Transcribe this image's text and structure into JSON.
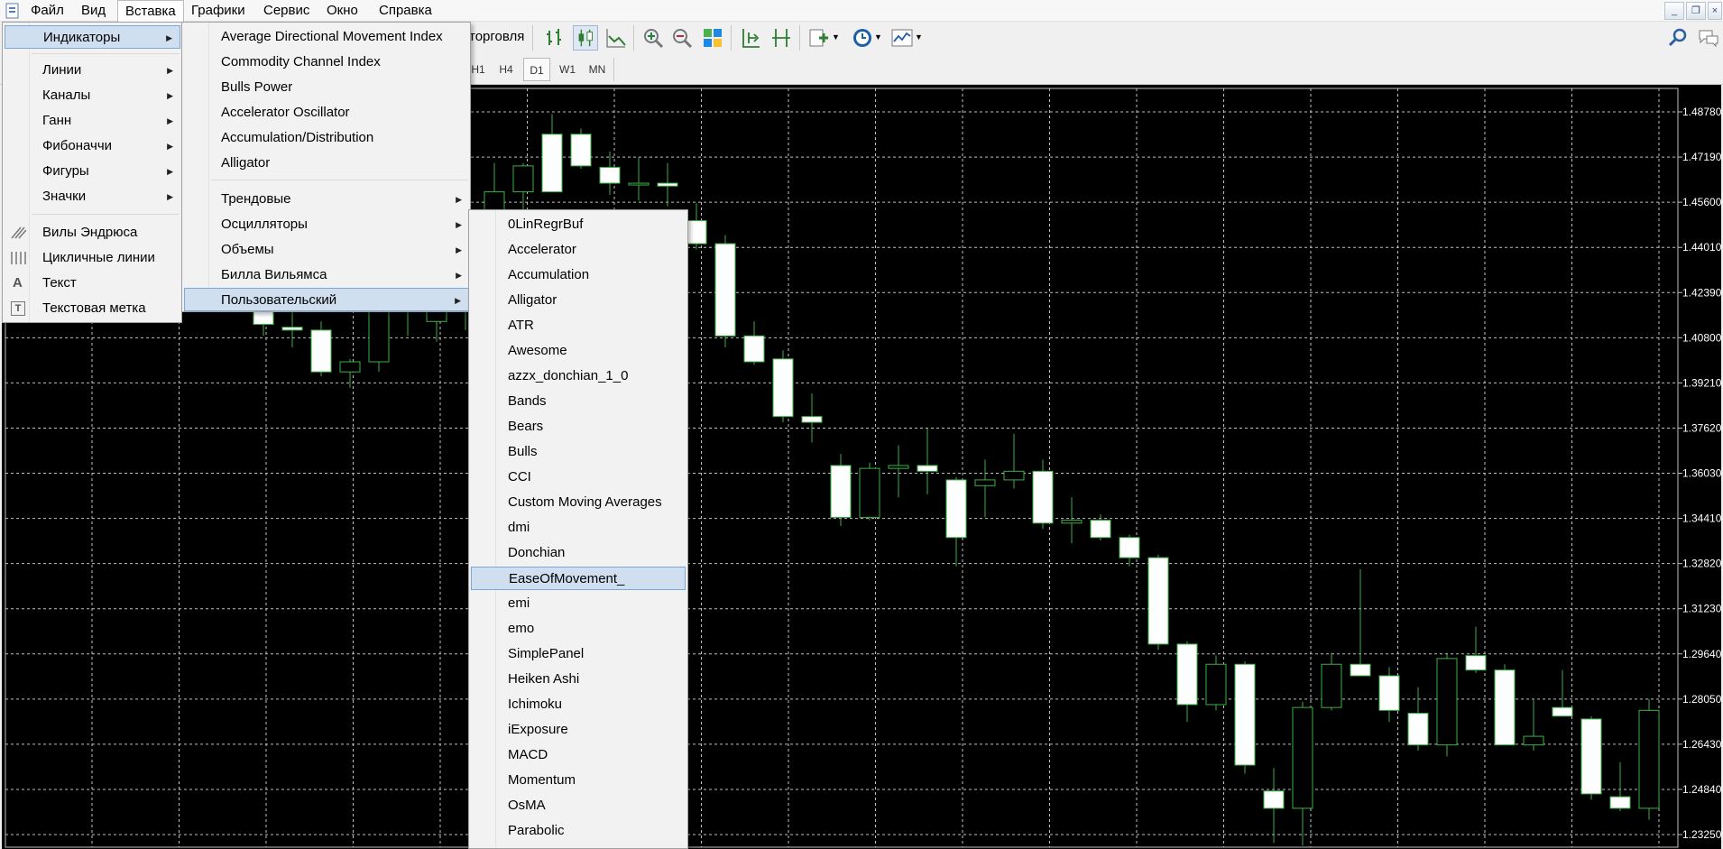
{
  "menubar": {
    "items": [
      "Файл",
      "Вид",
      "Вставка",
      "Графики",
      "Сервис",
      "Окно",
      "Справка"
    ],
    "active": "Вставка"
  },
  "toolbar": {
    "partial_label": "торговля",
    "timeframes": [
      "H1",
      "H4",
      "D1",
      "W1",
      "MN"
    ],
    "selected_timeframe": "D1"
  },
  "insert_menu": {
    "items": [
      {
        "label": "Индикаторы",
        "submenu": true,
        "highlighted": true
      },
      {
        "label": "Линии",
        "submenu": true
      },
      {
        "label": "Каналы",
        "submenu": true
      },
      {
        "label": "Ганн",
        "submenu": true
      },
      {
        "label": "Фибоначчи",
        "submenu": true
      },
      {
        "label": "Фигуры",
        "submenu": true
      },
      {
        "label": "Значки",
        "submenu": true
      },
      {
        "label": "Вилы Эндрюса",
        "icon": "pitchfork-icon"
      },
      {
        "label": "Цикличные линии",
        "icon": "cycle-lines-icon"
      },
      {
        "label": "Текст",
        "icon": "text-icon"
      },
      {
        "label": "Текстовая метка",
        "icon": "text-label-icon"
      }
    ]
  },
  "indicators_menu": {
    "items": [
      {
        "label": "Average Directional Movement Index"
      },
      {
        "label": "Commodity Channel Index"
      },
      {
        "label": "Bulls Power"
      },
      {
        "label": "Accelerator Oscillator"
      },
      {
        "label": "Accumulation/Distribution"
      },
      {
        "label": "Alligator"
      },
      {
        "label": "Трендовые",
        "submenu": true
      },
      {
        "label": "Осцилляторы",
        "submenu": true
      },
      {
        "label": "Объемы",
        "submenu": true
      },
      {
        "label": "Билла Вильямса",
        "submenu": true
      },
      {
        "label": "Пользовательский",
        "submenu": true,
        "highlighted": true
      }
    ]
  },
  "custom_menu": {
    "items": [
      "0LinRegrBuf",
      "Accelerator",
      "Accumulation",
      "Alligator",
      "ATR",
      "Awesome",
      "azzx_donchian_1_0",
      "Bands",
      "Bears",
      "Bulls",
      "CCI",
      "Custom Moving Averages",
      "dmi",
      "Donchian",
      "EaseOfMovement_",
      "emi",
      "emo",
      "SimplePanel",
      "Heiken Ashi",
      "Ichimoku",
      "iExposure",
      "MACD",
      "Momentum",
      "OsMA",
      "Parabolic"
    ],
    "highlighted": "EaseOfMovement_"
  },
  "chart": {
    "background": "#000000",
    "grid_color": "#c0c0c0",
    "candle_up_fill": "#000000",
    "candle_down_fill": "#ffffff",
    "candle_outline": "#3cb043",
    "price_labels": [
      "1.48780",
      "1.47190",
      "1.45600",
      "1.44010",
      "1.42390",
      "1.40800",
      "1.39210",
      "1.37620",
      "1.36030",
      "1.34410",
      "1.32820",
      "1.31230",
      "1.29640",
      "1.28050",
      "1.26430",
      "1.24840",
      "1.23250"
    ]
  },
  "chart_data": {
    "type": "candlestick",
    "ylim": [
      1.2325,
      1.4959
    ],
    "candles": [
      {
        "o": 1.425,
        "h": 1.43,
        "l": 1.41,
        "c": 1.414
      },
      {
        "o": 1.413,
        "h": 1.419,
        "l": 1.406,
        "c": 1.412
      },
      {
        "o": 1.412,
        "h": 1.415,
        "l": 1.396,
        "c": 1.3975
      },
      {
        "o": 1.3975,
        "h": 1.402,
        "l": 1.392,
        "c": 1.401
      },
      {
        "o": 1.401,
        "h": 1.426,
        "l": 1.3975,
        "c": 1.419
      },
      {
        "o": 1.421,
        "h": 1.428,
        "l": 1.41,
        "c": 1.42
      },
      {
        "o": 1.415,
        "h": 1.426,
        "l": 1.408,
        "c": 1.423
      },
      {
        "o": 1.419,
        "h": 1.45,
        "l": 1.412,
        "c": 1.44
      },
      {
        "o": 1.44,
        "h": 1.47,
        "l": 1.43,
        "c": 1.46
      },
      {
        "o": 1.46,
        "h": 1.47,
        "l": 1.445,
        "c": 1.469
      },
      {
        "o": 1.48,
        "h": 1.487,
        "l": 1.46,
        "c": 1.46
      },
      {
        "o": 1.48,
        "h": 1.482,
        "l": 1.468,
        "c": 1.469
      },
      {
        "o": 1.4685,
        "h": 1.474,
        "l": 1.459,
        "c": 1.463
      },
      {
        "o": 1.463,
        "h": 1.472,
        "l": 1.457,
        "c": 1.463
      },
      {
        "o": 1.463,
        "h": 1.47,
        "l": 1.455,
        "c": 1.462
      },
      {
        "o": 1.45,
        "h": 1.456,
        "l": 1.44,
        "c": 1.442
      },
      {
        "o": 1.442,
        "h": 1.445,
        "l": 1.406,
        "c": 1.41
      },
      {
        "o": 1.41,
        "h": 1.415,
        "l": 1.4,
        "c": 1.401
      },
      {
        "o": 1.402,
        "h": 1.405,
        "l": 1.38,
        "c": 1.382
      },
      {
        "o": 1.382,
        "h": 1.39,
        "l": 1.373,
        "c": 1.38
      },
      {
        "o": 1.365,
        "h": 1.369,
        "l": 1.344,
        "c": 1.347
      },
      {
        "o": 1.347,
        "h": 1.366,
        "l": 1.346,
        "c": 1.364
      },
      {
        "o": 1.364,
        "h": 1.372,
        "l": 1.354,
        "c": 1.365
      },
      {
        "o": 1.365,
        "h": 1.378,
        "l": 1.355,
        "c": 1.363
      },
      {
        "o": 1.36,
        "h": 1.361,
        "l": 1.33,
        "c": 1.34
      },
      {
        "o": 1.358,
        "h": 1.367,
        "l": 1.347,
        "c": 1.36
      },
      {
        "o": 1.36,
        "h": 1.376,
        "l": 1.357,
        "c": 1.363
      },
      {
        "o": 1.363,
        "h": 1.367,
        "l": 1.343,
        "c": 1.345
      },
      {
        "o": 1.345,
        "h": 1.354,
        "l": 1.338,
        "c": 1.346
      },
      {
        "o": 1.346,
        "h": 1.348,
        "l": 1.339,
        "c": 1.34
      },
      {
        "o": 1.34,
        "h": 1.341,
        "l": 1.33,
        "c": 1.333
      },
      {
        "o": 1.333,
        "h": 1.334,
        "l": 1.301,
        "c": 1.303
      },
      {
        "o": 1.303,
        "h": 1.304,
        "l": 1.276,
        "c": 1.282
      },
      {
        "o": 1.282,
        "h": 1.299,
        "l": 1.28,
        "c": 1.296
      },
      {
        "o": 1.296,
        "h": 1.297,
        "l": 1.258,
        "c": 1.261
      },
      {
        "o": 1.252,
        "h": 1.26,
        "l": 1.234,
        "c": 1.246
      },
      {
        "o": 1.246,
        "h": 1.283,
        "l": 1.233,
        "c": 1.281
      },
      {
        "o": 1.281,
        "h": 1.3,
        "l": 1.28,
        "c": 1.296
      },
      {
        "o": 1.296,
        "h": 1.329,
        "l": 1.293,
        "c": 1.292
      },
      {
        "o": 1.292,
        "h": 1.295,
        "l": 1.276,
        "c": 1.28
      },
      {
        "o": 1.279,
        "h": 1.288,
        "l": 1.266,
        "c": 1.268
      },
      {
        "o": 1.268,
        "h": 1.3,
        "l": 1.264,
        "c": 1.298
      },
      {
        "o": 1.299,
        "h": 1.309,
        "l": 1.293,
        "c": 1.294
      },
      {
        "o": 1.294,
        "h": 1.296,
        "l": 1.268,
        "c": 1.268
      },
      {
        "o": 1.268,
        "h": 1.284,
        "l": 1.266,
        "c": 1.271
      },
      {
        "o": 1.281,
        "h": 1.294,
        "l": 1.278,
        "c": 1.278
      },
      {
        "o": 1.277,
        "h": 1.278,
        "l": 1.249,
        "c": 1.251
      },
      {
        "o": 1.25,
        "h": 1.262,
        "l": 1.245,
        "c": 1.246
      },
      {
        "o": 1.246,
        "h": 1.284,
        "l": 1.242,
        "c": 1.28
      }
    ]
  }
}
